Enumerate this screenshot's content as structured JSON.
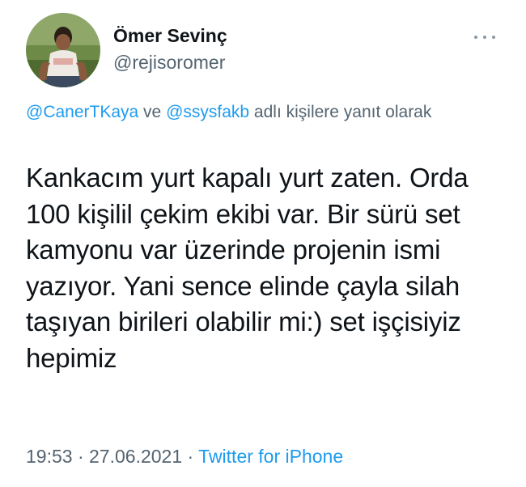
{
  "author": {
    "display_name": "Ömer Sevinç",
    "handle": "@rejisoromer"
  },
  "more_icon": "more-horizontal-icon",
  "reply_context": {
    "mention_1": "@CanerTKaya",
    "connector": " ve ",
    "mention_2": "@ssysfakb",
    "suffix": " adlı kişilere yanıt olarak"
  },
  "tweet_text": "Kankacım yurt kapalı yurt zaten. Orda 100 kişilil çekim ekibi var. Bir sürü set kamyonu var üzerinde projenin ismi yazıyor. Yani sence elinde çayla silah taşıyan birileri olabilir mi:) set işçisiyiz hepimiz",
  "meta": {
    "time": "19:53",
    "separator_1": " · ",
    "date": "27.06.2021",
    "separator_2": " · ",
    "source": "Twitter for iPhone"
  },
  "colors": {
    "link": "#1d9bf0",
    "secondary_text": "#536471",
    "primary_text": "#0f1419"
  }
}
